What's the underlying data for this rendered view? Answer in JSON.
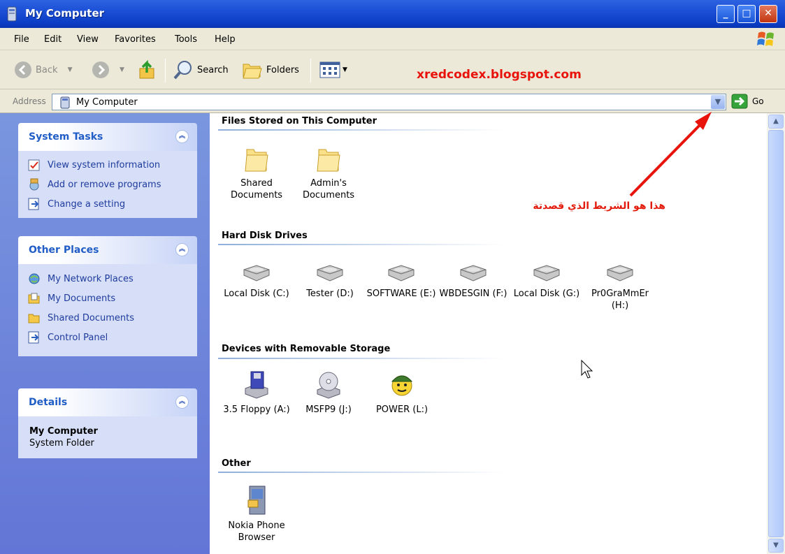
{
  "window": {
    "title": "My Computer",
    "controls": {
      "minimize": "_",
      "maximize": "□",
      "close": "✕"
    }
  },
  "menubar": {
    "items": [
      "File",
      "Edit",
      "View",
      "Favorites",
      "Tools",
      "Help"
    ]
  },
  "toolbar": {
    "back_label": "Back",
    "search_label": "Search",
    "folders_label": "Folders"
  },
  "watermark": "xredcodex.blogspot.com",
  "address": {
    "label": "Address",
    "value": "My Computer",
    "go_label": "Go"
  },
  "taskpane": {
    "system_tasks": {
      "title": "System Tasks",
      "items": [
        "View system information",
        "Add or remove programs",
        "Change a setting"
      ]
    },
    "other_places": {
      "title": "Other Places",
      "items": [
        "My Network Places",
        "My Documents",
        "Shared Documents",
        "Control Panel"
      ]
    },
    "details": {
      "title": "Details",
      "name": "My Computer",
      "type": "System Folder"
    }
  },
  "groups": {
    "files_stored": {
      "title": "Files Stored on This Computer",
      "items": [
        "Shared Documents",
        "Admin's Documents"
      ]
    },
    "hard_disks": {
      "title": "Hard Disk Drives",
      "items": [
        "Local Disk (C:)",
        "Tester (D:)",
        "SOFTWARE (E:)",
        "WBDESGIN (F:)",
        "Local Disk (G:)",
        "Pr0GraMmEr (H:)"
      ]
    },
    "removable": {
      "title": "Devices with Removable Storage",
      "items": [
        "3.5 Floppy (A:)",
        "MSFP9 (J:)",
        "POWER (L:)"
      ]
    },
    "other": {
      "title": "Other",
      "items": [
        "Nokia Phone Browser"
      ]
    }
  },
  "annotation": "هذا هو الشريط الذي قصدتة",
  "colors": {
    "titlebar": "#0b3cc4",
    "taskpane": "#6375d6",
    "link": "#215dc6",
    "annotation": "#e31b0c"
  }
}
